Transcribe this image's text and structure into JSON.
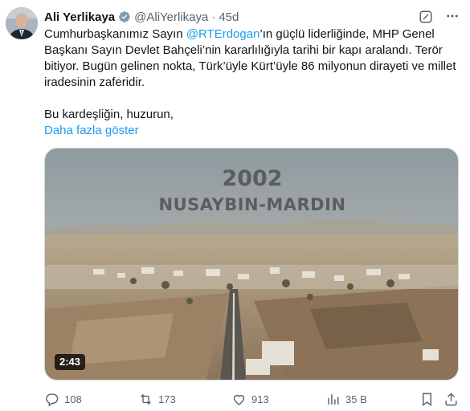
{
  "author": {
    "name": "Ali Yerlikaya",
    "handle": "@AliYerlikaya",
    "separator": "·",
    "time": "45d"
  },
  "tweet": {
    "line1_before": "Cumhurbaşkanımız Sayın ",
    "mention": "@RTErdogan",
    "line1_after": "’ın güçlü liderliğinde, MHP Genel Başkanı Sayın Devlet Bahçeli’nin kararlılığıyla tarihi bir kapı aralandı. Terör bitiyor. Bugün gelinen nokta, Türk’üyle Kürt’üyle 86 milyonun dirayeti ve millet iradesinin zaferidir.",
    "paragraph2": "Bu kardeşliğin, huzurun,",
    "show_more": "Daha fazla göster"
  },
  "media": {
    "overlay_year": "2002",
    "overlay_place": "NUSAYBIN-MARDIN",
    "duration": "2:43"
  },
  "actions": {
    "replies": "108",
    "reposts": "173",
    "likes": "913",
    "views": "35 B"
  },
  "colors": {
    "accent": "#1d9bf0",
    "secondary_text": "#536471",
    "primary_text": "#0f1419"
  },
  "icons": [
    "verified-badge-icon",
    "grok-icon",
    "more-icon",
    "reply-icon",
    "repost-icon",
    "like-icon",
    "views-icon",
    "bookmark-icon",
    "share-icon"
  ]
}
